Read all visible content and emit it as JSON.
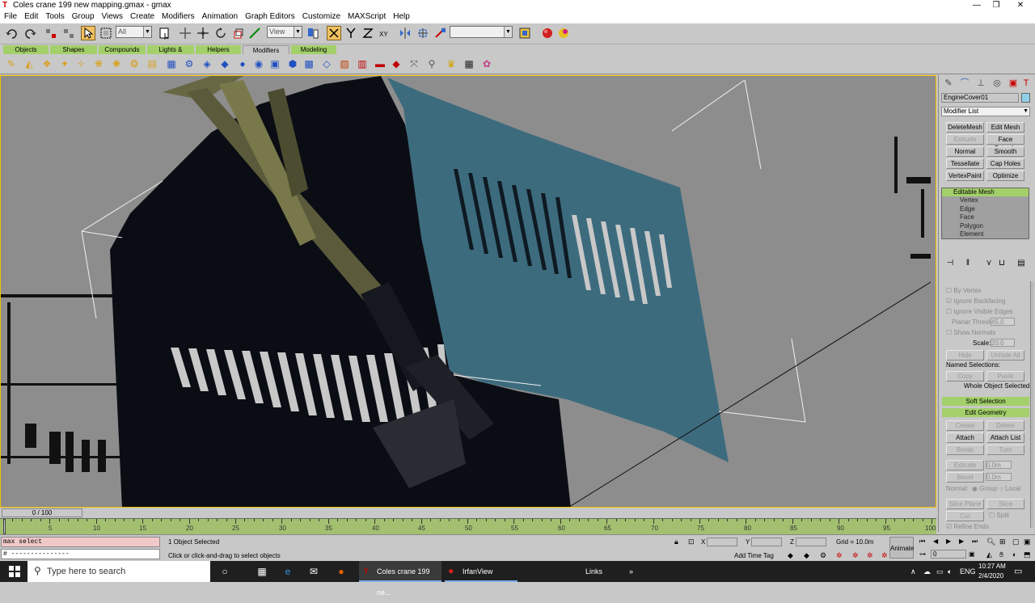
{
  "window": {
    "title": "Coles crane 199 new mapping.gmax - gmax",
    "controls": [
      "—",
      "❐",
      "✕"
    ]
  },
  "menu": [
    "File",
    "Edit",
    "Tools",
    "Group",
    "Views",
    "Create",
    "Modifiers",
    "Animation",
    "Graph Editors",
    "Customize",
    "MAXScript",
    "Help"
  ],
  "toolbar": {
    "selection_filter": "All",
    "coord_system": "View",
    "named_selection": ""
  },
  "tabs": [
    "Objects",
    "Shapes",
    "Compounds",
    "Lights & Cameras",
    "Helpers",
    "Modifiers",
    "Modeling"
  ],
  "command_panel": {
    "object_name": "EngineCover01",
    "modifier_list": "Modifier List",
    "modifier_buttons": [
      {
        "label": "DeleteMesh",
        "enabled": true
      },
      {
        "label": "Edit Mesh",
        "enabled": true
      },
      {
        "label": "Extrude",
        "enabled": false
      },
      {
        "label": "Face Extrude",
        "enabled": true
      },
      {
        "label": "Normal",
        "enabled": true
      },
      {
        "label": "Smooth",
        "enabled": true
      },
      {
        "label": "Tessellate",
        "enabled": true
      },
      {
        "label": "Cap Holes",
        "enabled": true
      },
      {
        "label": "VertexPaint",
        "enabled": true
      },
      {
        "label": "Optimize",
        "enabled": true
      }
    ],
    "stack": {
      "header": "Editable Mesh",
      "items": [
        "Vertex",
        "Edge",
        "Face",
        "Polygon",
        "Element"
      ]
    },
    "selection": {
      "by_vertex": "By Vertex",
      "ignore_backfacing": "Ignore Backfacing",
      "ignore_visible_edges": "Ignore Visible Edges",
      "planar_thresh_label": "Planar Thresh:",
      "planar_thresh_value": "45.0",
      "show_normals": "Show Normals",
      "scale_label": "Scale:",
      "scale_value": "20.0",
      "hide": "Hide",
      "unhide_all": "Unhide All",
      "named_selections": "Named Selections:",
      "copy": "Copy",
      "paste": "Paste",
      "whole_object": "Whole Object Selected"
    },
    "rollouts": {
      "soft_selection": "Soft Selection",
      "edit_geometry": "Edit Geometry"
    },
    "edit_geometry": {
      "create": "Create",
      "delete": "Delete",
      "attach": "Attach",
      "attach_list": "Attach List",
      "break": "Break",
      "turn": "Turn",
      "extrude": "Extrude",
      "extrude_value": "0.0m",
      "bevel": "Bevel",
      "bevel_value": "0.0m",
      "normal_label": "Normal:",
      "group": "Group",
      "local": "Local",
      "slice_plane": "Slice Plane",
      "slice": "Slice",
      "cut": "Cut",
      "split": "Split",
      "refine_ends": "Refine Ends"
    }
  },
  "timeline": {
    "frame_label": "0 / 100",
    "ticks": [
      10,
      15,
      20,
      25,
      30,
      35,
      40,
      45,
      50,
      55,
      60,
      65,
      70,
      75,
      80,
      85,
      90,
      95,
      100
    ],
    "ticks_left": [
      5
    ]
  },
  "status": {
    "maxscript_line1": "max select",
    "maxscript_line2": "# ---------------",
    "selected": "1 Object Selected",
    "prompt": "Click or click-and-drag to select objects",
    "x_label": "X",
    "y_label": "Y",
    "z_label": "Z",
    "grid": "Grid = 10.0m",
    "add_time_tag": "Add Time Tag",
    "animate": "Animate",
    "frame_value": "0"
  },
  "taskbar": {
    "search_placeholder": "Type here to search",
    "tasks": [
      {
        "label": "Coles crane 199 ne...",
        "active": true
      },
      {
        "label": "IrfanView",
        "active": false
      }
    ],
    "links": "Links",
    "lang": "ENG",
    "time": "10:27 AM",
    "date": "2/4/2020"
  },
  "colors": {
    "accent_green": "#a3d06a",
    "active_button": "#f0c060",
    "viewport_bg": "#8a8a8a",
    "cover_blue": "#3d6b7e",
    "dark_body": "#0b0d14"
  }
}
